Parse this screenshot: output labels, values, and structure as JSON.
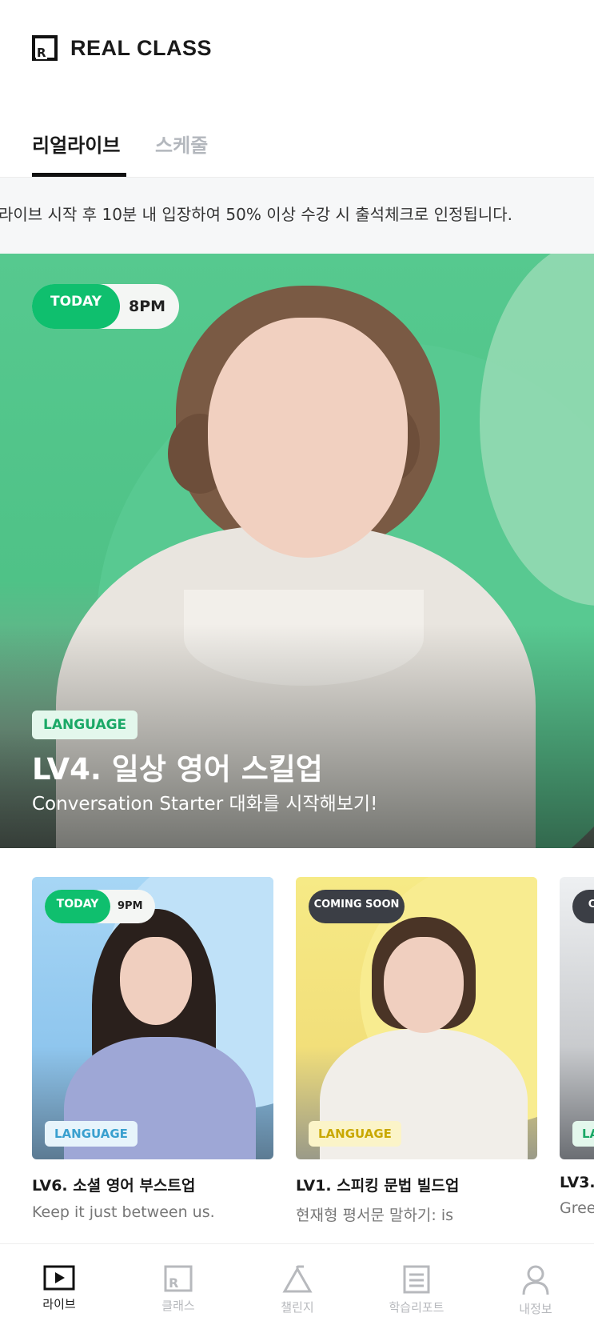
{
  "header": {
    "logo_letter": "R",
    "logo_text": "REAL CLASS"
  },
  "tabs": [
    {
      "label": "리얼라이브",
      "active": true
    },
    {
      "label": "스케줄",
      "active": false
    }
  ],
  "notice": {
    "text": "라이브 시작 후 10분 내 입장하여 50% 이상 수강 시 출석체크로 인정됩니다."
  },
  "hero": {
    "day_label": "TODAY",
    "time": "8PM",
    "badge": "LANGUAGE",
    "title": "LV4. 일상 영어 스킬업",
    "subtitle": "Conversation Starter 대화를 시작해보기!",
    "accent_color": "#0fbf6e"
  },
  "cards": [
    {
      "day_label": "TODAY",
      "time": "9PM",
      "badge": "LANGUAGE",
      "title": "LV6. 소셜 영어 부스트업",
      "subtitle": "Keep it just between us."
    },
    {
      "status_label": "COMING SOON",
      "badge": "LANGUAGE",
      "title": "LV1. 스피킹 문법 빌드업",
      "subtitle": "현재형 평서문 말하기: is"
    },
    {
      "status_label": "CO",
      "badge": "LA",
      "title": "LV3.",
      "subtitle": "Gree"
    }
  ],
  "bottom_nav": [
    {
      "label": "라이브",
      "icon": "play-icon",
      "active": true
    },
    {
      "label": "클래스",
      "icon": "class-icon",
      "active": false
    },
    {
      "label": "챌린지",
      "icon": "challenge-icon",
      "active": false
    },
    {
      "label": "학습리포트",
      "icon": "report-icon",
      "active": false
    },
    {
      "label": "내정보",
      "icon": "profile-icon",
      "active": false
    }
  ]
}
